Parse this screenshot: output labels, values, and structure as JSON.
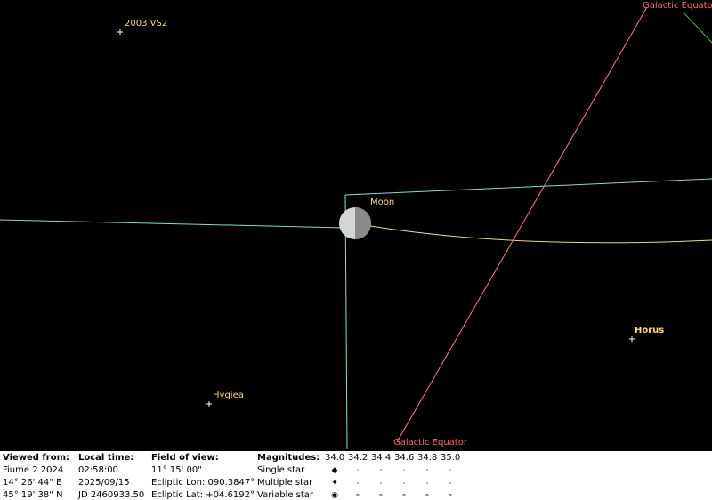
{
  "labels": {
    "galactic_equator_top": "Galactic Equator",
    "galactic_equator_bottom": "Galactic Equator",
    "asteroid_1": "2003 VS2",
    "moon": "Moon",
    "horus": "Horus",
    "hygiea": "Hygiea"
  },
  "panel": {
    "viewed_from": {
      "header": "Viewed from:",
      "line1": "Fiume 2 2024",
      "line2": "14° 26' 44\" E",
      "line3": "45° 19' 38\" N"
    },
    "local_time": {
      "header": "Local time:",
      "line1": "02:58:00",
      "line2": "2025/09/15",
      "line3": "JD 2460933.50"
    },
    "field_of_view": {
      "header": "Field of view:",
      "line1": "11° 15' 00\"",
      "line2": "Ecliptic Lon: 090.3847°",
      "line3": "Ecliptic Lat: +04.6192°"
    },
    "magnitudes": {
      "header": "Magnitudes:",
      "values": [
        "34.0",
        "34.2",
        "34.4",
        "34.6",
        "34.8",
        "35.0"
      ],
      "rows": [
        "Single star",
        "Multiple star",
        "Variable star"
      ]
    }
  },
  "colors": {
    "background": "#000000",
    "label": "#ffd86e",
    "galactic_equator": "#ff6b6b",
    "boundary": "#7fe0e0",
    "ecliptic": "#f0e070"
  }
}
